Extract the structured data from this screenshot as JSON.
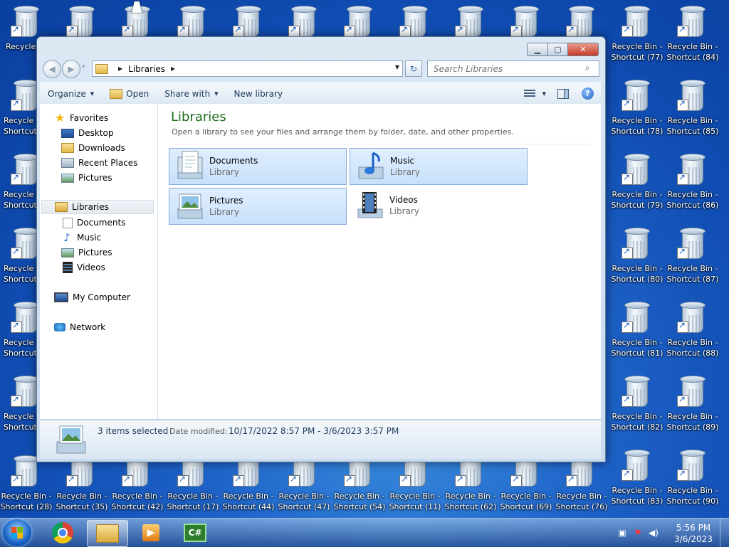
{
  "desktop": {
    "icons_top_row": [
      "Recycle",
      "",
      "",
      "",
      "",
      "",
      "",
      "",
      "",
      "",
      ""
    ],
    "right_col1": [
      "Recycle Bin - Shortcut (77)",
      "Recycle Bin - Shortcut (78)",
      "Recycle Bin - Shortcut (79)",
      "Recycle Bin - Shortcut (80)",
      "Recycle Bin - Shortcut (81)",
      "Recycle Bin - Shortcut (82)",
      "Recycle Bin - Shortcut (83)"
    ],
    "right_col2": [
      "Recycle Bin - Shortcut (84)",
      "Recycle Bin - Shortcut (85)",
      "Recycle Bin - Shortcut (86)",
      "Recycle Bin - Shortcut (87)",
      "Recycle Bin - Shortcut (88)",
      "Recycle Bin - Shortcut (89)",
      "Recycle Bin - Shortcut (90)"
    ],
    "left_col": [
      "Recycle I Shortcut",
      "Recycle I Shortcut",
      "Recycle I Shortcut",
      "Recycle I Shortcut",
      "Recycle I Shortcut"
    ],
    "bottom_row": [
      {
        "line1": "Recycle Bin -",
        "line2": "Shortcut (28)"
      },
      {
        "line1": "Recycle Bin -",
        "line2": "Shortcut (35)"
      },
      {
        "line1": "Recycle Bin -",
        "line2": "Shortcut (42)"
      },
      {
        "line1": "Recycle Bin -",
        "line2": "Shortcut (17)"
      },
      {
        "line1": "Recycle Bin -",
        "line2": "Shortcut (44)"
      },
      {
        "line1": "Recycle Bin -",
        "line2": "Shortcut (47)"
      },
      {
        "line1": "Recycle Bin -",
        "line2": "Shortcut (54)"
      },
      {
        "line1": "Recycle Bin -",
        "line2": "Shortcut (11)"
      },
      {
        "line1": "Recycle Bin -",
        "line2": "Shortcut (62)"
      },
      {
        "line1": "Recycle Bin -",
        "line2": "Shortcut (69)"
      },
      {
        "line1": "Recycle Bin -",
        "line2": "Shortcut (76)"
      },
      {
        "line1": "Recycle Bin -",
        "line2": "Shortcut (83)"
      },
      {
        "line1": "Recycle Bin -",
        "line2": "Shortcut (90)"
      }
    ]
  },
  "window": {
    "caption": {
      "minimize": "▁",
      "maximize": "▢",
      "close": "✕"
    },
    "nav": {
      "back": "◀",
      "forward": "▶",
      "history": "▾"
    },
    "address": {
      "crumb": "Libraries",
      "sep1": "▶",
      "sep2": "▶",
      "dropdown": "▼"
    },
    "refresh": "↻",
    "search": {
      "placeholder": "Search Libraries",
      "icon": "search-icon"
    },
    "toolbar": {
      "organize": "Organize",
      "open": "Open",
      "share_with": "Share with",
      "new_library": "New library",
      "help": "?"
    },
    "navpane": {
      "favorites": "Favorites",
      "desktop": "Desktop",
      "downloads": "Downloads",
      "recent_places": "Recent Places",
      "pictures": "Pictures",
      "libraries": "Libraries",
      "lib_documents": "Documents",
      "lib_music": "Music",
      "lib_pictures": "Pictures",
      "lib_videos": "Videos",
      "my_computer": "My Computer",
      "network": "Network"
    },
    "content": {
      "title": "Libraries",
      "subtitle": "Open a library to see your files and arrange them by folder, date, and other properties.",
      "tiles": [
        {
          "name": "Documents",
          "type": "Library",
          "selected": true
        },
        {
          "name": "Music",
          "type": "Library",
          "selected": true
        },
        {
          "name": "Pictures",
          "type": "Library",
          "selected": true
        },
        {
          "name": "Videos",
          "type": "Library",
          "selected": false
        }
      ]
    },
    "details": {
      "selected": "3 items selected",
      "date_label": "Date modified:",
      "date_value": "10/17/2022 8:57 PM - 3/6/2023 3:57 PM"
    }
  },
  "taskbar": {
    "clock_time": "5:56 PM",
    "clock_date": "3/6/2023",
    "csharp_label": "C#"
  }
}
